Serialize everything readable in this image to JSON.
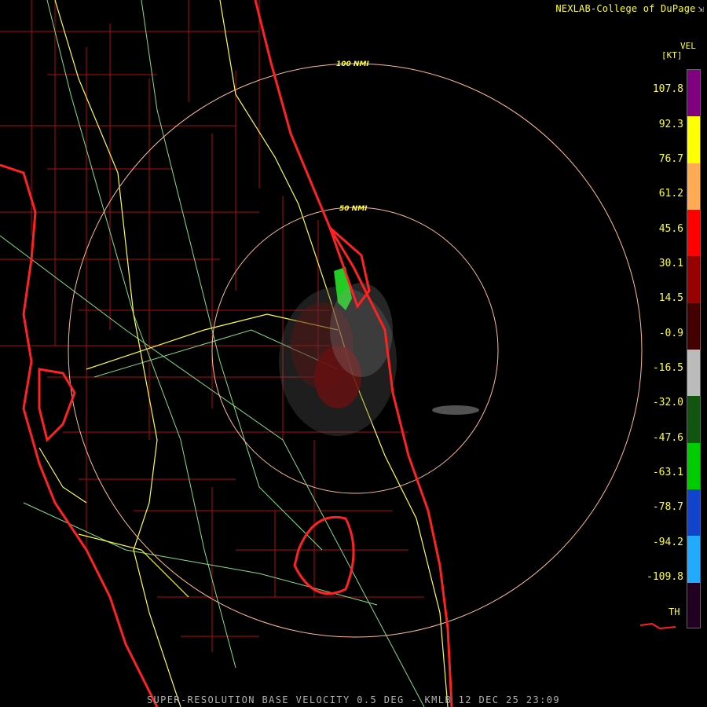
{
  "credit": "NEXLAB-College of DuPage",
  "credit_icon": "resize-corner-icon",
  "product_label": "SUPER-RESOLUTION BASE VELOCITY 0.5 DEG - KMLB 12 DEC 25 23:09",
  "legend": {
    "variable": "VEL",
    "unit": "[KT]",
    "ticks": [
      "107.8",
      "92.3",
      "76.7",
      "61.2",
      "45.6",
      "30.1",
      "14.5",
      "-0.9",
      "-16.5",
      "-32.0",
      "-47.6",
      "-63.1",
      "-78.7",
      "-94.2",
      "-109.8"
    ],
    "th_label": "TH",
    "colors": [
      "#800080",
      "#ffff00",
      "#ffaa55",
      "#ff0000",
      "#990000",
      "#440000",
      "#bbbbbb",
      "#115511",
      "#00cc00",
      "#1144cc",
      "#22aaff",
      "#220022"
    ]
  },
  "range_rings": [
    "50 NMI",
    "100 NMI"
  ],
  "colors": {
    "county_lines": "#aa1111",
    "state_boundary": "#ff2222",
    "highways": "#ffff44",
    "roads": "#88dd88",
    "range_ring": "#ffbb99"
  }
}
